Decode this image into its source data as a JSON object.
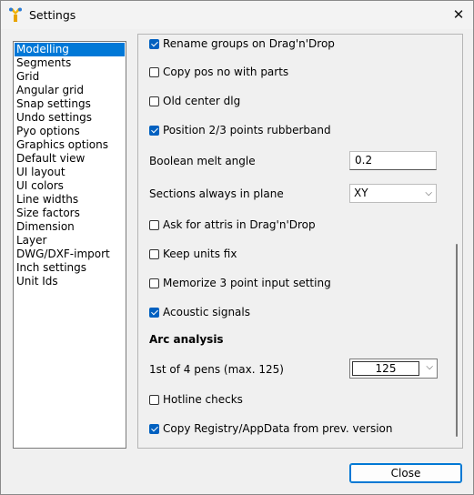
{
  "window": {
    "title": "Settings"
  },
  "nav": {
    "items": [
      {
        "label": "Modelling",
        "selected": true
      },
      {
        "label": "Segments"
      },
      {
        "label": "Grid"
      },
      {
        "label": "Angular grid"
      },
      {
        "label": "Snap settings"
      },
      {
        "label": "Undo settings"
      },
      {
        "label": "Pyo options"
      },
      {
        "label": "Graphics options"
      },
      {
        "label": "Default view"
      },
      {
        "label": "UI layout"
      },
      {
        "label": "UI colors"
      },
      {
        "label": "Line widths"
      },
      {
        "label": "Size factors"
      },
      {
        "label": "Dimension"
      },
      {
        "label": "Layer"
      },
      {
        "label": "DWG/DXF-import"
      },
      {
        "label": "Inch settings"
      },
      {
        "label": "Unit Ids"
      }
    ]
  },
  "panel": {
    "rename_groups": {
      "label": "Rename groups on Drag'n'Drop",
      "checked": true
    },
    "copy_pos": {
      "label": "Copy pos no with parts",
      "checked": false
    },
    "old_center": {
      "label": "Old center dlg",
      "checked": false
    },
    "position_rubberband": {
      "label": "Position 2/3 points rubberband",
      "checked": true
    },
    "boolean_melt": {
      "label": "Boolean melt angle",
      "value": "0.2"
    },
    "sections_plane": {
      "label": "Sections always in plane",
      "value": "XY"
    },
    "ask_attris": {
      "label": "Ask for attris in Drag'n'Drop",
      "checked": false
    },
    "keep_units": {
      "label": "Keep units fix",
      "checked": false
    },
    "memorize_input": {
      "label": "Memorize 3 point input setting",
      "checked": false
    },
    "acoustic": {
      "label": "Acoustic signals",
      "checked": true
    },
    "arc_heading": "Arc analysis",
    "pens": {
      "label": "1st of 4 pens (max. 125)",
      "value": "125"
    },
    "hotline": {
      "label": "Hotline checks",
      "checked": false
    },
    "copy_registry": {
      "label": "Copy Registry/AppData from prev. version",
      "checked": true
    }
  },
  "buttons": {
    "close": "Close"
  },
  "colors": {
    "accent": "#0078d7",
    "checkbox": "#0060c0"
  }
}
